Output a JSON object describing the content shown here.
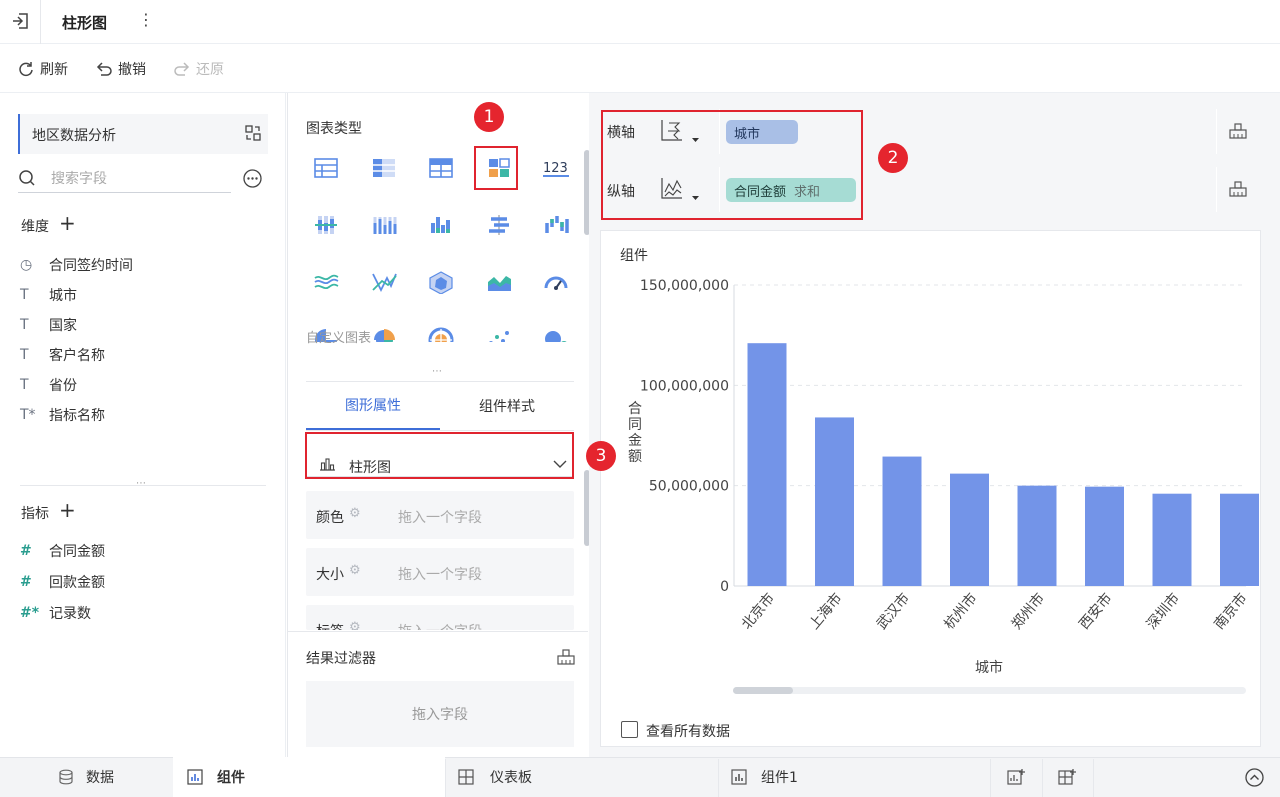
{
  "header": {
    "title": "柱形图",
    "more_icon": "more-vertical-icon",
    "back_icon": "exit-icon"
  },
  "toolbar": {
    "refresh": "刷新",
    "undo": "撤销",
    "redo": "还原"
  },
  "left": {
    "dataset": "地区数据分析",
    "search_placeholder": "搜索字段",
    "dimension_title": "维度",
    "dimensions": [
      {
        "icon": "clock-icon",
        "glyph": "◷",
        "label": "合同签约时间"
      },
      {
        "icon": "text-icon",
        "glyph": "T",
        "label": "城市"
      },
      {
        "icon": "text-icon",
        "glyph": "T",
        "label": "国家"
      },
      {
        "icon": "text-icon",
        "glyph": "T",
        "label": "客户名称"
      },
      {
        "icon": "text-icon",
        "glyph": "T",
        "label": "省份"
      },
      {
        "icon": "text-calc-icon",
        "glyph": "T*",
        "label": "指标名称"
      }
    ],
    "metric_title": "指标",
    "metrics": [
      {
        "icon": "number-icon",
        "glyph": "#",
        "label": "合同金额"
      },
      {
        "icon": "number-icon",
        "glyph": "#",
        "label": "回款金额"
      },
      {
        "icon": "number-calc-icon",
        "glyph": "#*",
        "label": "记录数"
      }
    ]
  },
  "middle": {
    "chart_type_title": "图表类型",
    "custom_chart": "自定义图表",
    "tabs": [
      "图形属性",
      "组件样式"
    ],
    "selected_graph": "柱形图",
    "props": [
      {
        "label": "颜色",
        "placeholder": "拖入一个字段"
      },
      {
        "label": "大小",
        "placeholder": "拖入一个字段"
      },
      {
        "label": "标签",
        "placeholder": "拖入一个字段"
      }
    ],
    "filter_title": "结果过滤器",
    "filter_placeholder": "拖入字段"
  },
  "axes": {
    "x_label": "横轴",
    "x_field": "城市",
    "y_label": "纵轴",
    "y_field": "合同金额",
    "y_agg": "求和"
  },
  "badges": [
    "1",
    "2",
    "3"
  ],
  "chart_card": {
    "title": "组件",
    "show_all": "查看所有数据"
  },
  "chart_data": {
    "type": "bar",
    "categories": [
      "北京市",
      "上海市",
      "武汉市",
      "杭州市",
      "郑州市",
      "西安市",
      "深圳市",
      "南京市"
    ],
    "values": [
      121000000,
      84000000,
      64500000,
      56000000,
      50000000,
      49500000,
      46000000,
      46000000
    ],
    "ylabel": "合同金额",
    "xlabel": "城市",
    "yticks": [
      "0",
      "50,000,000",
      "100,000,000",
      "150,000,000"
    ],
    "ylim": [
      0,
      150000000
    ],
    "bar_color": "#7394e8"
  },
  "bottom": {
    "tabs": [
      {
        "icon": "database-icon",
        "label": "数据"
      },
      {
        "icon": "bar-chart-icon",
        "label": "组件"
      },
      {
        "icon": "dashboard-icon",
        "label": "仪表板"
      },
      {
        "icon": "bar-chart-icon",
        "label": "组件1"
      }
    ]
  },
  "colors": {
    "accent": "#3e6ed8",
    "highlight_red": "#e0242f",
    "pill_blue": "#a9bfe6",
    "pill_green": "#a6dcd4"
  }
}
